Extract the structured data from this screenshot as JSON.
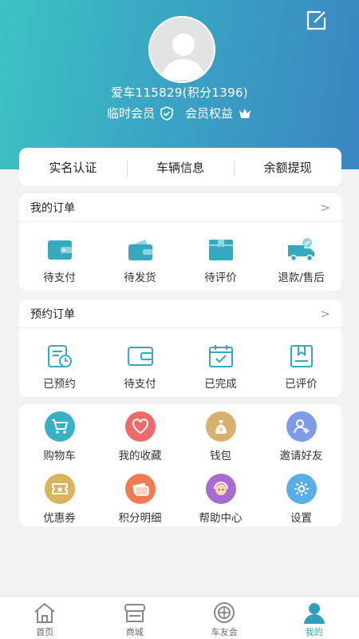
{
  "profile": {
    "nickname": "爱车115829(积分1396)",
    "member_level": "临时会员",
    "member_benefits": "会员权益"
  },
  "quick_actions": [
    "实名认证",
    "车辆信息",
    "余额提现"
  ],
  "my_orders": {
    "title": "我的订单",
    "more": ">",
    "items": [
      {
        "label": "待支付",
        "icon": "wallet-icon"
      },
      {
        "label": "待发货",
        "icon": "wallet-open-icon"
      },
      {
        "label": "待评价",
        "icon": "box-icon"
      },
      {
        "label": "退款/售后",
        "icon": "truck-icon"
      }
    ]
  },
  "booking_orders": {
    "title": "预约订单",
    "more": ">",
    "items": [
      {
        "label": "已预约",
        "icon": "calendar-clock-icon"
      },
      {
        "label": "待支付",
        "icon": "wallet-outline-icon"
      },
      {
        "label": "已完成",
        "icon": "calendar-check-icon"
      },
      {
        "label": "已评价",
        "icon": "bookmark-icon"
      }
    ]
  },
  "services": [
    {
      "label": "购物车",
      "icon": "cart-icon",
      "color": "#3ab0c8"
    },
    {
      "label": "我的收藏",
      "icon": "heart-icon",
      "color": "#ef6a6a"
    },
    {
      "label": "钱包",
      "icon": "money-bag-icon",
      "color": "#d7b070"
    },
    {
      "label": "邀请好友",
      "icon": "add-user-icon",
      "color": "#7e9be9"
    },
    {
      "label": "优惠券",
      "icon": "coupon-icon",
      "color": "#d9b45c"
    },
    {
      "label": "积分明细",
      "icon": "points-icon",
      "color": "#f07a52"
    },
    {
      "label": "帮助中心",
      "icon": "support-icon",
      "color": "#a86bd2"
    },
    {
      "label": "设置",
      "icon": "gear-icon",
      "color": "#5aaee8"
    }
  ],
  "tabbar": [
    {
      "label": "首页",
      "icon": "home-icon"
    },
    {
      "label": "商城",
      "icon": "shop-icon"
    },
    {
      "label": "车友会",
      "icon": "wheel-icon"
    },
    {
      "label": "我的",
      "icon": "user-icon",
      "active": true
    }
  ],
  "colors": {
    "accent": "#3aa5c4",
    "header_start": "#3cc3c2",
    "header_end": "#3a86c2"
  }
}
